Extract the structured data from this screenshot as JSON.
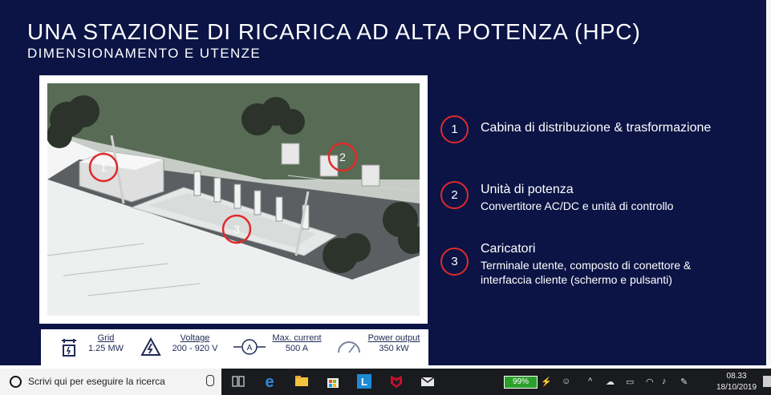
{
  "slide": {
    "title": "UNA STAZIONE DI RICARICA AD ALTA POTENZA (HPC)",
    "subtitle": "DIMENSIONAMENTO E UTENZE",
    "image_markers": [
      "1",
      "2",
      "3"
    ],
    "legend": [
      {
        "num": "1",
        "title": "Cabina di distribuzione & trasformazione",
        "sub": []
      },
      {
        "num": "2",
        "title": "Unità di potenza",
        "sub": [
          "Convertitore AC/DC e unità di controllo"
        ]
      },
      {
        "num": "3",
        "title": "Caricatori",
        "sub": [
          "Terminale utente, composto di conettore &",
          "interfaccia cliente (schermo e pulsanti)"
        ]
      }
    ],
    "specs": [
      {
        "label": "Grid",
        "value": "1.25 MW",
        "icon": "grid-icon"
      },
      {
        "label": "Voltage",
        "value": "200 - 920 V",
        "icon": "high-voltage-icon"
      },
      {
        "label": "Max. current",
        "value": "500 A",
        "icon": "ammeter-icon"
      },
      {
        "label": "Power output",
        "value": "350 kW",
        "icon": "gauge-icon"
      }
    ],
    "accent_color": "#e02a2a",
    "background_color": "#0b1445"
  },
  "taskbar": {
    "search_placeholder": "Scrivi qui per eseguire la ricerca",
    "apps": [
      "task-view-icon",
      "edge-icon",
      "file-explorer-icon",
      "store-icon",
      "app-l-icon",
      "mcafee-icon",
      "mail-icon"
    ],
    "app_l_letter": "L",
    "battery": "99%",
    "time": "08.33",
    "date": "18/10/2019"
  }
}
